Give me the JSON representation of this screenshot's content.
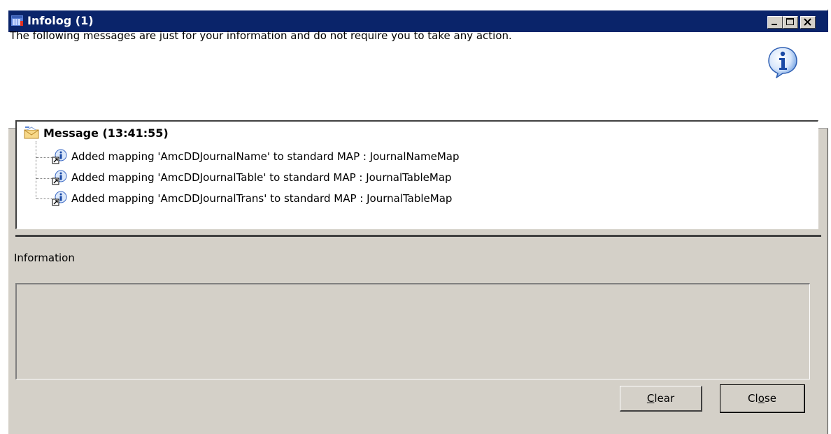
{
  "window": {
    "title": "Infolog (1)",
    "controls": {
      "minimize": "minimize",
      "maximize": "maximize",
      "close": "close"
    }
  },
  "header": {
    "message": "The following messages are just for your information and do not require you to take any action.",
    "icon": "info-icon"
  },
  "tree": {
    "root": {
      "label": "Message (13:41:55)",
      "icon": "envelope-icon"
    },
    "items": [
      {
        "label": "Added mapping 'AmcDDJournalName' to standard MAP : JournalNameMap",
        "icon": "info-shortcut-icon"
      },
      {
        "label": "Added mapping 'AmcDDJournalTable' to standard MAP : JournalTableMap",
        "icon": "info-shortcut-icon"
      },
      {
        "label": "Added mapping 'AmcDDJournalTrans' to standard MAP : JournalTableMap",
        "icon": "info-shortcut-icon"
      }
    ]
  },
  "details": {
    "label": "Information",
    "value": ""
  },
  "buttons": {
    "clear": {
      "before": "",
      "mnemonic": "C",
      "after": "lear"
    },
    "close": {
      "before": "Cl",
      "mnemonic": "o",
      "after": "se"
    }
  },
  "colors": {
    "titlebar": "#0a246a",
    "window": "#d4d0c8",
    "panel": "#ffffff"
  }
}
